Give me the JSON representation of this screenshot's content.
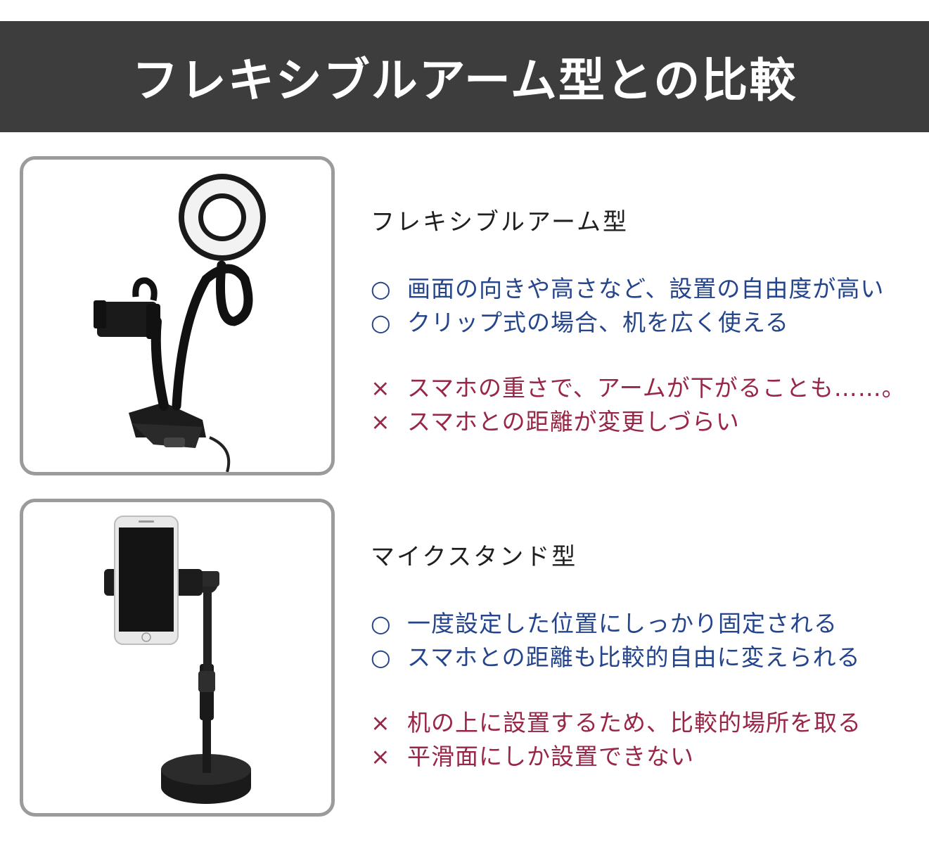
{
  "header": {
    "title": "フレキシブルアーム型との比較"
  },
  "colors": {
    "header_bg": "#3d3d3d",
    "pro": "#24448c",
    "con": "#982646",
    "frame_border": "#9b9b9b"
  },
  "sections": [
    {
      "title": "フレキシブルアーム型",
      "image_icon": "flexible-arm-ring-light-photo",
      "pros_mark": "○",
      "cons_mark": "×",
      "pros": [
        "画面の向きや高さなど、設置の自由度が高い",
        "クリップ式の場合、机を広く使える"
      ],
      "cons": [
        "スマホの重さで、アームが下がることも……。",
        "スマホとの距離が変更しづらい"
      ]
    },
    {
      "title": "マイクスタンド型",
      "image_icon": "mic-stand-phone-holder-photo",
      "pros_mark": "○",
      "cons_mark": "×",
      "pros": [
        "一度設定した位置にしっかり固定される",
        "スマホとの距離も比較的自由に変えられる"
      ],
      "cons": [
        "机の上に設置するため、比較的場所を取る",
        "平滑面にしか設置できない"
      ]
    }
  ]
}
